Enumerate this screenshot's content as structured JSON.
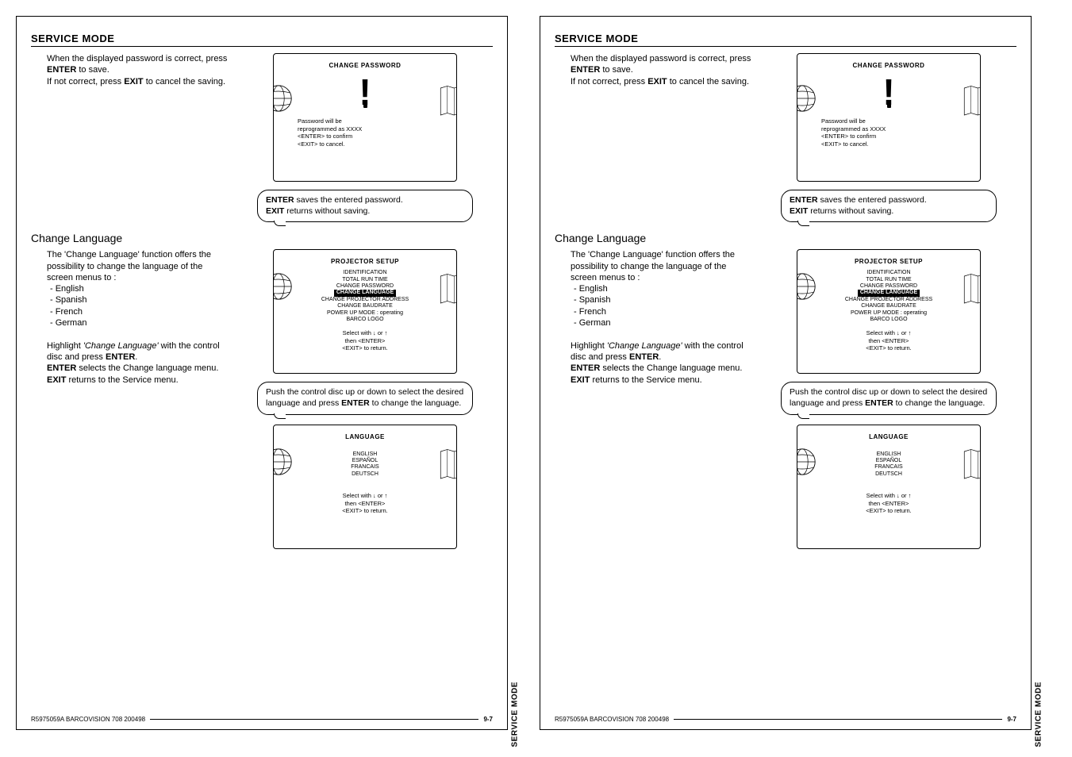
{
  "header": "SERVICE MODE",
  "para1_a": "When the displayed password is correct, press ",
  "para1_b": "ENTER",
  "para1_c": " to save.",
  "para2_a": "If not correct, press ",
  "para2_b": "EXIT",
  "para2_c": " to cancel the saving.",
  "screen1": {
    "title": "CHANGE  PASSWORD",
    "line1": "Password  will  be",
    "line2": "reprogrammed  as  XXXX",
    "line3": "<ENTER>  to  confirm",
    "line4": "<EXIT>  to  cancel."
  },
  "bubble1_a": "ENTER",
  "bubble1_b": " saves the entered password.",
  "bubble1_c": "EXIT",
  "bubble1_d": " returns without saving.",
  "section2": "Change Language",
  "para3": "The 'Change Language' function offers the possibility to change the language of the screen menus to :",
  "langs": [
    "- English",
    "- Spanish",
    "- French",
    "- German"
  ],
  "para4_a": "Highlight ",
  "para4_b": "'Change Language'",
  "para4_c": " with the control disc and press ",
  "para4_d": "ENTER",
  "para4_e": ".",
  "para5_a": "ENTER",
  "para5_b": " selects the Change language menu.",
  "para6_a": "EXIT",
  "para6_b": " returns to the Service menu.",
  "screen2": {
    "title": "PROJECTOR  SETUP",
    "items": [
      "IDENTIFICATION",
      "TOTAL  RUN  TIME",
      "CHANGE  PASSWORD"
    ],
    "hl": "CHANGE  LANGUAGE",
    "items2": [
      "CHANGE  PROJECTOR  ADDRESS",
      "CHANGE  BAUDRATE",
      "POWER  UP  MODE  :  operating",
      "BARCO  LOGO"
    ],
    "sel1": "Select with  ↓ or ↑",
    "sel2": "then  <ENTER>",
    "sel3": "<EXIT>  to  return."
  },
  "bubble2_a": "Push the control disc up or down to select the desired language and press ",
  "bubble2_b": "ENTER",
  "bubble2_c": " to change the language.",
  "screen3": {
    "title": "LANGUAGE",
    "items": [
      "ENGLISH",
      "ESPAÑOL",
      "FRANCAIS",
      "DEUTSCH"
    ],
    "sel1": "Select with  ↓ or ↑",
    "sel2": "then  <ENTER>",
    "sel3": "<EXIT>  to  return."
  },
  "sidetab": "SERVICE MODE",
  "footer_left": "R5975059A BARCOVISION 708  200498",
  "footer_right": "9-7"
}
